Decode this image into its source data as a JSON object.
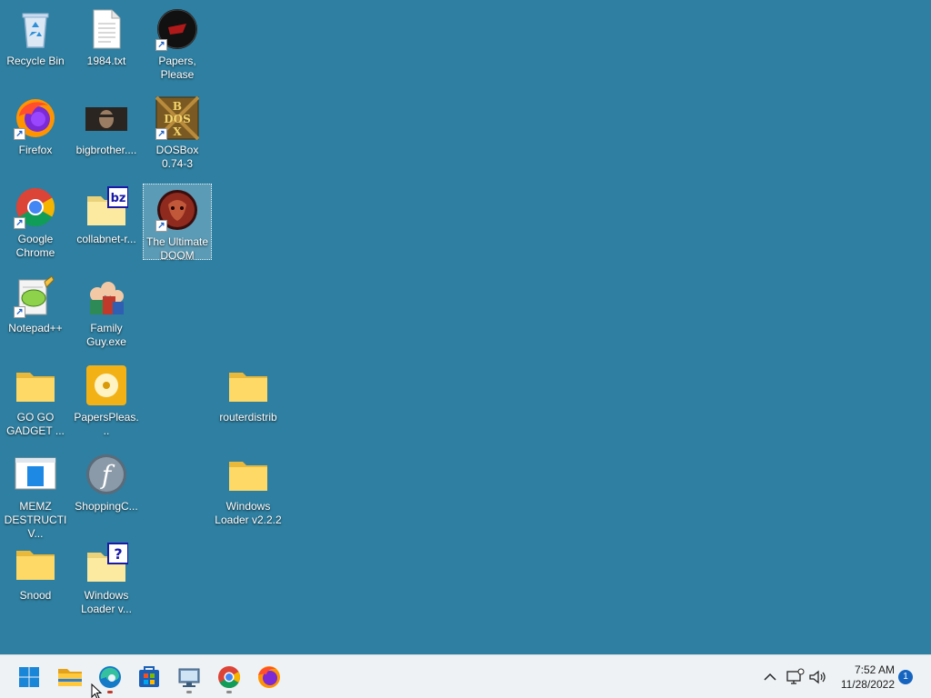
{
  "desktop": {
    "icons": [
      {
        "label": "Recycle Bin",
        "icon": "recycle-bin-icon"
      },
      {
        "label": "1984.txt",
        "icon": "text-file-icon"
      },
      {
        "label": "Papers, Please",
        "icon": "papers-please-icon"
      },
      {
        "label": "Firefox",
        "icon": "firefox-icon"
      },
      {
        "label": "bigbrother....",
        "icon": "image-file-icon"
      },
      {
        "label": "DOSBox\n0.74-3",
        "icon": "dosbox-icon"
      },
      {
        "label": "Google\nChrome",
        "icon": "chrome-icon"
      },
      {
        "label": "collabnet-r...",
        "icon": "archive-folder-icon"
      },
      {
        "label": "The Ultimate\nDOOM",
        "icon": "doom-icon"
      },
      {
        "label": "Notepad++",
        "icon": "notepadpp-icon"
      },
      {
        "label": "Family\nGuy.exe",
        "icon": "family-guy-icon"
      },
      {
        "label": "GO GO\nGADGET ...",
        "icon": "folder-icon"
      },
      {
        "label": "PapersPleas...",
        "icon": "disc-image-icon"
      },
      {
        "label": "routerdistrib",
        "icon": "folder-icon"
      },
      {
        "label": "MEMZ\nDESTRUCTIV...",
        "icon": "executable-icon"
      },
      {
        "label": "ShoppingC...",
        "icon": "flash-icon"
      },
      {
        "label": "Windows\nLoader v2.2.2",
        "icon": "folder-icon"
      },
      {
        "label": "Snood",
        "icon": "folder-icon"
      },
      {
        "label": "Windows\nLoader v...",
        "icon": "help-folder-icon"
      }
    ]
  },
  "taskbar": {
    "items": [
      {
        "icon": "windows-start-icon"
      },
      {
        "icon": "file-explorer-icon"
      },
      {
        "icon": "edge-icon"
      },
      {
        "icon": "store-icon"
      },
      {
        "icon": "remote-desktop-icon"
      },
      {
        "icon": "chrome-icon"
      },
      {
        "icon": "firefox-icon"
      }
    ],
    "tray": {
      "time": "7:52 AM",
      "date": "11/28/2022",
      "notification_count": "1"
    }
  }
}
